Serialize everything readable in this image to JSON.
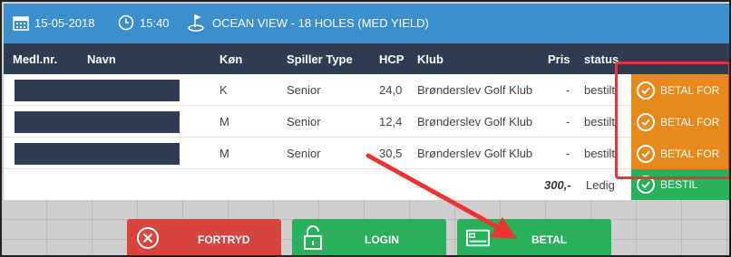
{
  "header": {
    "date": "15-05-2018",
    "time": "15:40",
    "course": "OCEAN VIEW - 18 HOLES (MED YIELD)",
    "colors": {
      "bar": "#3a8fcc"
    }
  },
  "table": {
    "columns": [
      "Medl.nr.",
      "Navn",
      "Køn",
      "Spiller Type",
      "HCP",
      "Klub",
      "Pris",
      "status"
    ],
    "rows": [
      {
        "kon": "K",
        "type": "Senior",
        "hcp": "24,0",
        "klub": "Brønderslev Golf Klub",
        "pris": "-",
        "status": "bestilt",
        "action": "BETAL FOR"
      },
      {
        "kon": "M",
        "type": "Senior",
        "hcp": "12,4",
        "klub": "Brønderslev Golf Klub",
        "pris": "-",
        "status": "bestilt",
        "action": "BETAL FOR"
      },
      {
        "kon": "M",
        "type": "Senior",
        "hcp": "30,5",
        "klub": "Brønderslev Golf Klub",
        "pris": "-",
        "status": "bestilt",
        "action": "BETAL FOR"
      }
    ],
    "total": {
      "pris": "300,-",
      "status": "Ledig",
      "action": "BESTIL"
    }
  },
  "buttons": {
    "cancel": "FORTRYD",
    "login": "LOGIN",
    "pay": "BETAL"
  },
  "colors": {
    "orange": "#e8891b",
    "green": "#29b05a",
    "red": "#d9453e",
    "annotation": "#e33333"
  }
}
